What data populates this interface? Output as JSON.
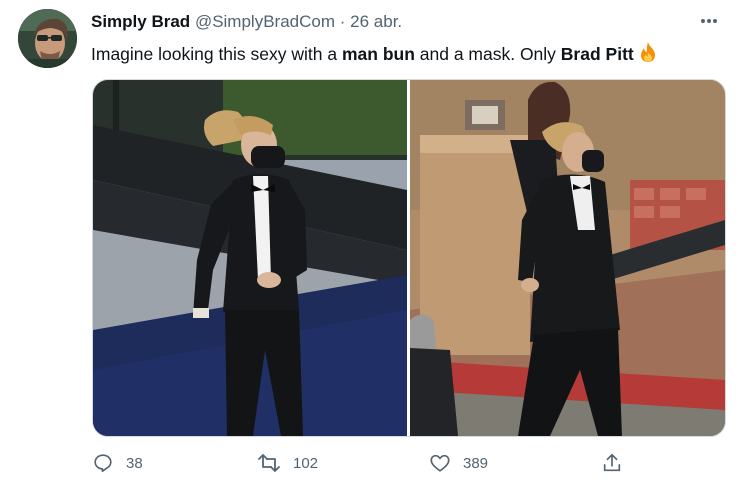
{
  "tweet": {
    "display_name": "Simply Brad",
    "handle": "@SimplyBradCom",
    "separator": "·",
    "date": "26 abr.",
    "text": {
      "part1": "Imagine looking this sexy with a ",
      "bold1": "man bun",
      "part2": " and a mask. Only ",
      "bold2": "Brad Pitt",
      "emoji": "fire-emoji"
    },
    "media": [
      {
        "icon": "photo-man-in-tuxedo-posing-on-blue-carpet"
      },
      {
        "icon": "photo-man-in-tuxedo-walking-outdoors"
      }
    ]
  },
  "actions": {
    "reply_count": "38",
    "retweet_count": "102",
    "like_count": "389"
  },
  "colors": {
    "text_primary": "#0f1419",
    "text_secondary": "#536471",
    "border": "#cfd9de",
    "fire": "#f4900c"
  }
}
